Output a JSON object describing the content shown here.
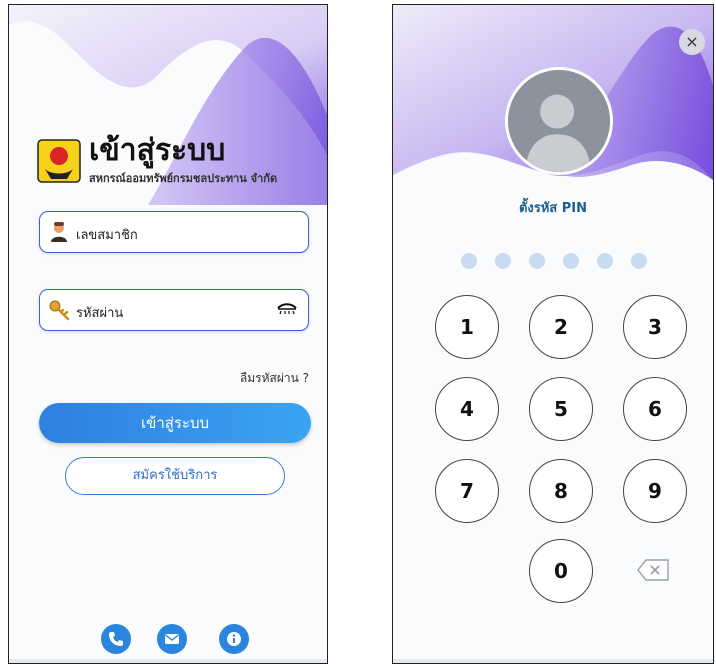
{
  "login": {
    "title": "เข้าสู่ระบบ",
    "subtitle": "สหกรณ์ออมทรัพย์กรมชลประทาน จำกัด",
    "member_placeholder": "เลขสมาชิก",
    "password_placeholder": "รหัสผ่าน",
    "forgot_password": "ลืมรหัสผ่าน ?",
    "login_button": "เข้าสู่ระบบ",
    "register_button": "สมัครใช้บริการ",
    "contact_icons": [
      "phone-icon",
      "mail-icon",
      "info-icon"
    ]
  },
  "pin": {
    "close_icon": "×",
    "title": "ตั้งรหัส PIN",
    "dot_count": 6,
    "keys": [
      "1",
      "2",
      "3",
      "4",
      "5",
      "6",
      "7",
      "8",
      "9",
      "0"
    ],
    "delete_icon": "backspace-icon"
  },
  "colors": {
    "accent": "#2f7fe0",
    "wave_purple": "#7a5ee0",
    "pin_dot": "#c9dbf0"
  }
}
